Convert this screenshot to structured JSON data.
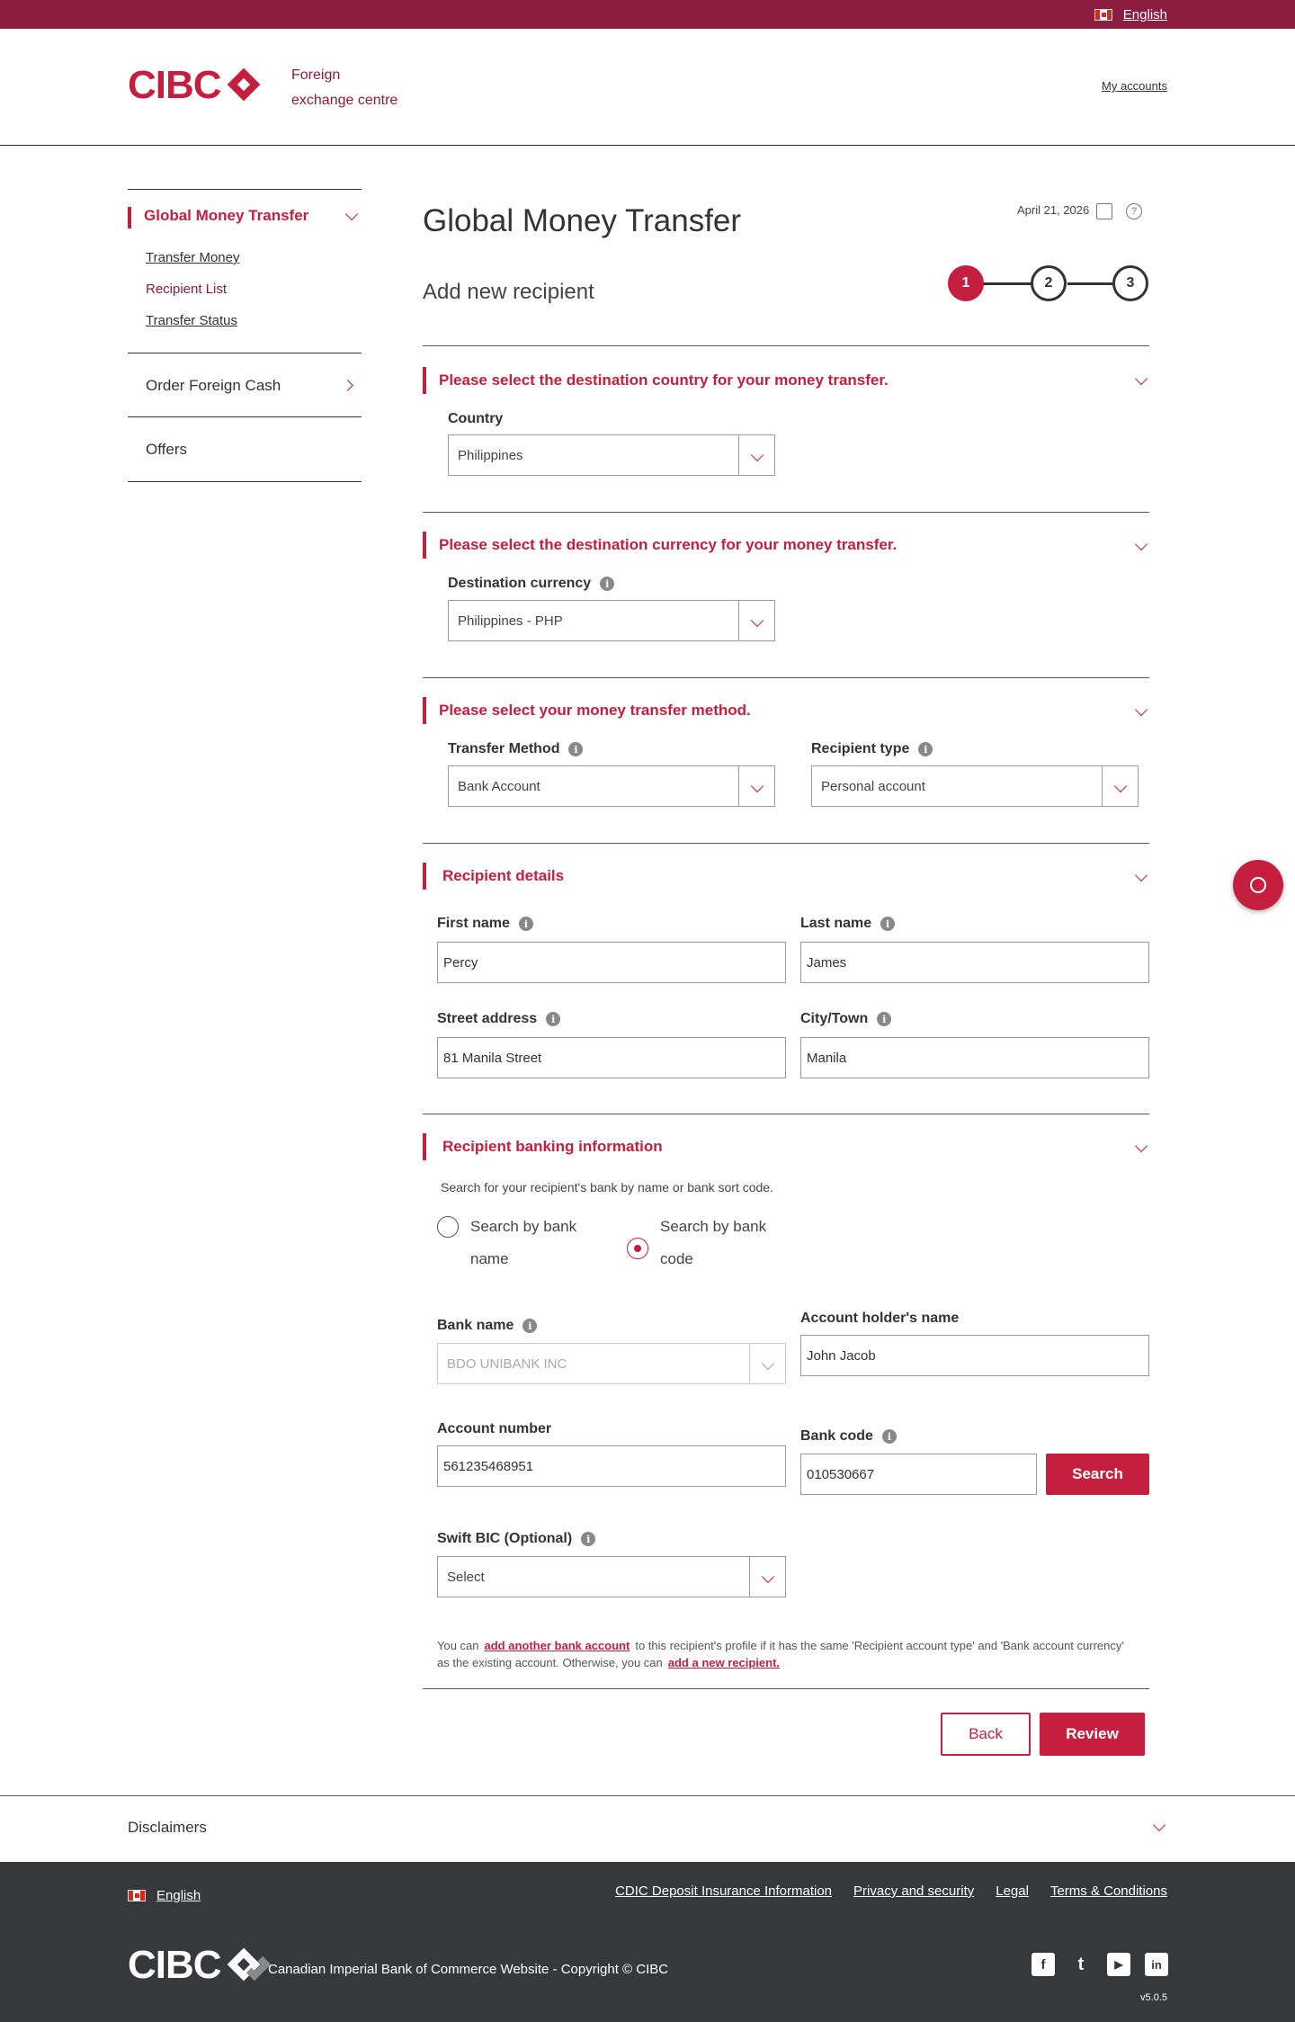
{
  "topbar": {
    "language": "English"
  },
  "header": {
    "logo": "CIBC",
    "title_line1": "Foreign",
    "title_line2": "exchange centre",
    "my_accounts": "My accounts"
  },
  "sidebar": {
    "active": "Global Money Transfer",
    "sub_items": [
      "Transfer Money",
      "Recipient List",
      "Transfer Status"
    ],
    "items": [
      "Order Foreign Cash",
      "Offers"
    ]
  },
  "main": {
    "title": "Global Money Transfer",
    "subtitle": "Add new recipient",
    "date": "April 21, 2026",
    "steps": [
      "1",
      "2",
      "3"
    ],
    "country_section": {
      "heading": "Please select the destination country for your money transfer.",
      "label": "Country",
      "value": "Philippines"
    },
    "currency_section": {
      "heading": "Please select the destination currency for your money transfer.",
      "label": "Destination currency",
      "value": "Philippines - PHP"
    },
    "method_section": {
      "heading": "Please select your money transfer method.",
      "method_label": "Transfer Method",
      "method_value": "Bank Account",
      "type_label": "Recipient type",
      "type_value": "Personal account"
    },
    "recipient_section": {
      "heading": "Recipient details",
      "first_name_label": "First name",
      "first_name": "Percy",
      "last_name_label": "Last name",
      "last_name": "James",
      "street_label": "Street address",
      "street": "81 Manila Street",
      "city_label": "City/Town",
      "city": "Manila"
    },
    "banking_section": {
      "heading": "Recipient banking information",
      "hint": "Search for your recipient's bank by name or bank sort code.",
      "radio_name_1": "Search by bank",
      "radio_name_2": "name",
      "radio_code_1": "Search by bank",
      "radio_code_2": "code",
      "bank_name_label": "Bank name",
      "bank_name_value": "BDO UNIBANK INC",
      "holder_label": "Account holder's name",
      "holder_value": "John Jacob",
      "account_label": "Account number",
      "account_value": "561235468951",
      "bank_code_label": "Bank code",
      "bank_code_value": "010530667",
      "search_button": "Search",
      "swift_label": "Swift BIC (Optional)",
      "swift_value": "Select"
    },
    "note": {
      "part1": "You can",
      "link1": "add another bank account",
      "part2": "to this recipient's profile if it has the same 'Recipient account type' and 'Bank account currency'",
      "part3": "as the existing account. Otherwise, you can",
      "link2": "add a new recipient."
    },
    "back_button": "Back",
    "review_button": "Review"
  },
  "disclaimers": "Disclaimers",
  "footer": {
    "language": "English",
    "links": [
      "CDIC Deposit Insurance Information",
      "Privacy and security",
      "Legal",
      "Terms & Conditions"
    ],
    "logo": "CIBC",
    "copyright": "Canadian Imperial Bank of Commerce Website - Copyright © CIBC",
    "social": [
      "f",
      "t",
      "▶",
      "in"
    ],
    "version": "v5.0.5"
  },
  "colors": {
    "brand": "#c41f3e",
    "topbar": "#8b1d41",
    "footer": "#36383b"
  }
}
